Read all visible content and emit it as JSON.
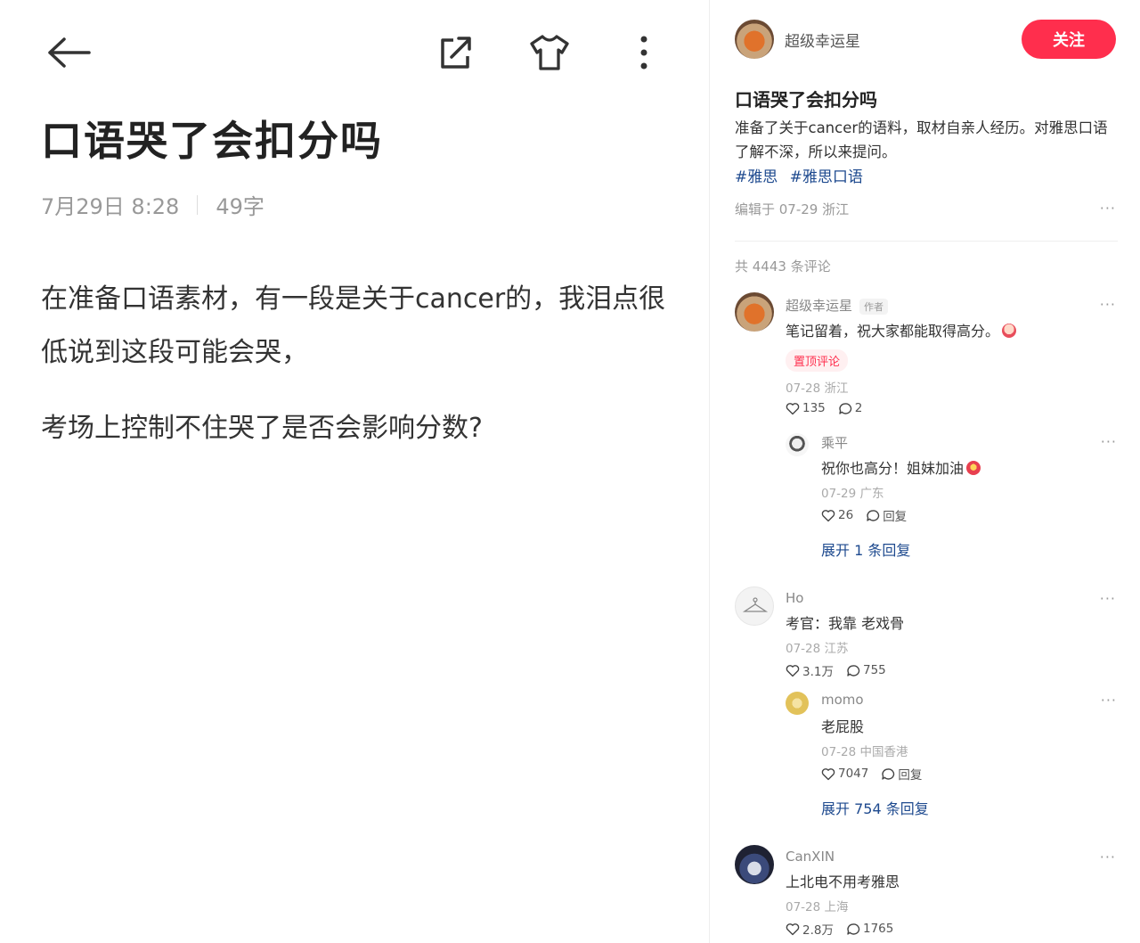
{
  "note": {
    "title": "口语哭了会扣分吗",
    "date": "7月29日 8:28",
    "word_count": "49字",
    "paragraphs": [
      "在准备口语素材，有一段是关于cancer的，我泪点很低说到这段可能会哭，",
      "考场上控制不住哭了是否会影响分数?"
    ]
  },
  "toolbar": {
    "back_icon": "arrow-left-icon",
    "share_icon": "share-icon",
    "shirt_icon": "tshirt-icon",
    "more_icon": "more-vertical-icon"
  },
  "sidebar": {
    "author_name": "超级幸运星",
    "follow_label": "关注",
    "title": "口语哭了会扣分吗",
    "description": "准备了关于cancer的语料，取材自亲人经历。对雅思口语了解不深，所以来提问。",
    "tags": [
      "#雅思",
      "#雅思口语"
    ],
    "edited": "编辑于 07-29 浙江",
    "more": "···",
    "comment_count": "共 4443 条评论"
  },
  "comments": [
    {
      "name": "超级幸运星",
      "badge": "作者",
      "text": "笔记留着，祝大家都能取得高分。",
      "pin": "置顶评论",
      "date": "07-28 浙江",
      "likes": "135",
      "replies_count": "2",
      "more": "···",
      "reply": {
        "name": "乘平",
        "text": "祝你也高分！姐妹加油",
        "date": "07-29 广东",
        "likes": "26",
        "reply_label": "回复",
        "more": "···"
      },
      "expand": "展开 1 条回复"
    },
    {
      "name": "Ho",
      "text": "考官：我靠 老戏骨",
      "date": "07-28 江苏",
      "likes": "3.1万",
      "replies_count": "755",
      "more": "···",
      "reply": {
        "name": "momo",
        "text": "老屁股",
        "date": "07-28 中国香港",
        "likes": "7047",
        "reply_label": "回复",
        "more": "···"
      },
      "expand": "展开 754 条回复"
    },
    {
      "name": "CanXIN",
      "text": "上北电不用考雅思",
      "date": "07-28 上海",
      "likes": "2.8万",
      "replies_count": "1765",
      "more": "···"
    }
  ],
  "colors": {
    "accent": "#ff2e4d",
    "link": "#1e4a8f",
    "muted": "#999999"
  }
}
